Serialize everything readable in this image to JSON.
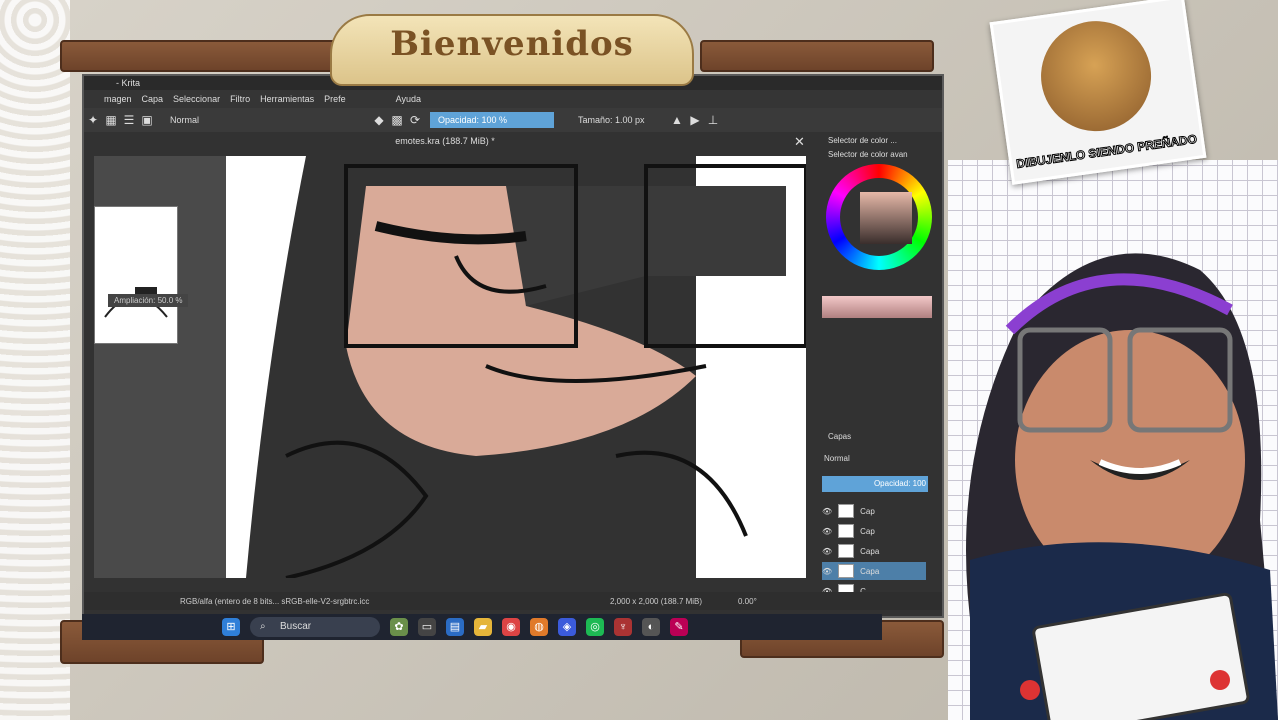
{
  "overlay": {
    "banner_text": "Bienvenidos",
    "meme_caption": "DIBUJENLO SIENDO PREÑADO"
  },
  "krita": {
    "window_title": "- Krita",
    "menu": [
      "magen",
      "Capa",
      "Seleccionar",
      "Filtro",
      "Herramientas",
      "Prefe",
      "Ayuda"
    ],
    "blend_mode": "Normal",
    "opacity_label": "Opacidad: 100 %",
    "size_label": "Tamaño: 1.00 px",
    "document_title": "emotes.kra (188.7 MiB) *",
    "zoom_tooltip": "Ampliación: 50.0 %",
    "color_selector_title": "Selector de color ...",
    "color_selector_sub": "Selector de color avan",
    "layers_title": "Capas",
    "layers_blend": "Normal",
    "layers_opacity": "Opacidad: 100",
    "layers": [
      "Cap",
      "Cap",
      "Capa",
      "Capa",
      "C"
    ],
    "status_color": "RGB/alfa (entero de 8 bits... sRGB-elle-V2-srgbtrc.icc",
    "status_size": "2,000 x 2,000 (188.7 MiB)",
    "status_rotation": "0.00°"
  },
  "taskbar": {
    "search_label": "Buscar"
  }
}
